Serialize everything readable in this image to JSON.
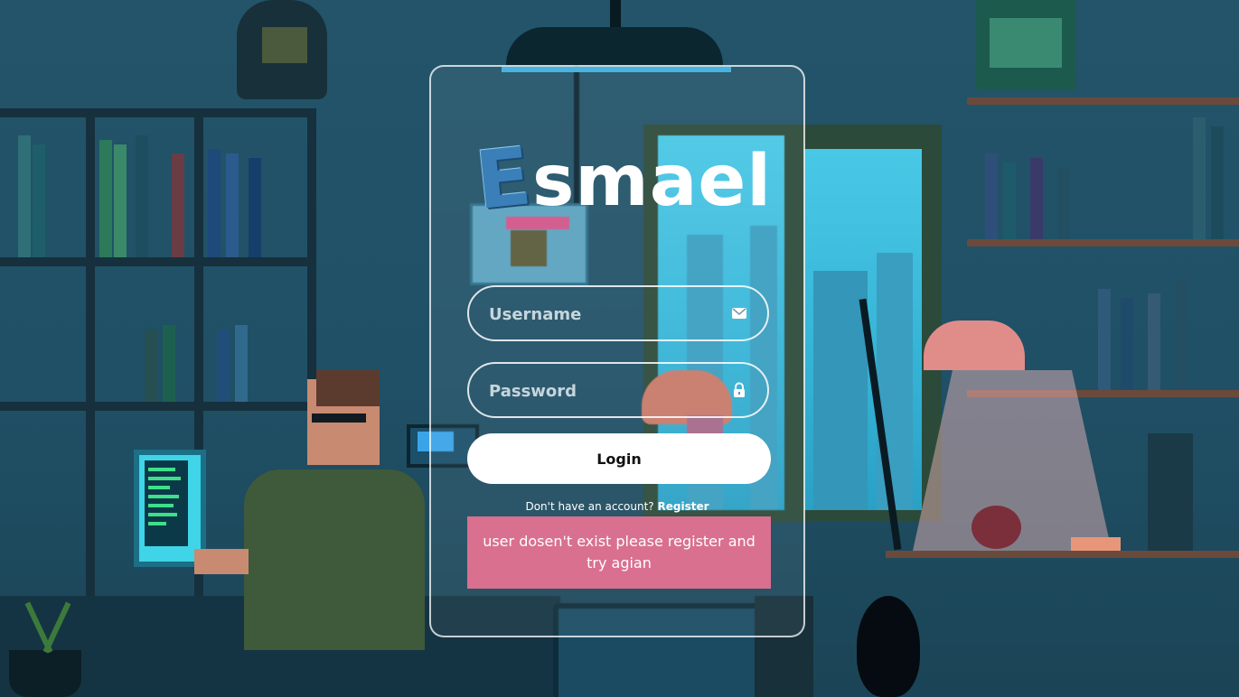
{
  "logo": {
    "initial": "E",
    "text": "smael"
  },
  "form": {
    "username_placeholder": "Username",
    "password_placeholder": "Password",
    "login_label": "Login",
    "username_icon": "envelope-icon",
    "password_icon": "lock-icon"
  },
  "register": {
    "prompt": "Don't have an account?",
    "link_label": "Register"
  },
  "error": {
    "message": "user dosen't exist please register and try agian"
  },
  "colors": {
    "card_border": "#ffffff",
    "error_bg": "#d9708f",
    "button_bg": "#ffffff",
    "accent_bar": "#49b3e0"
  }
}
